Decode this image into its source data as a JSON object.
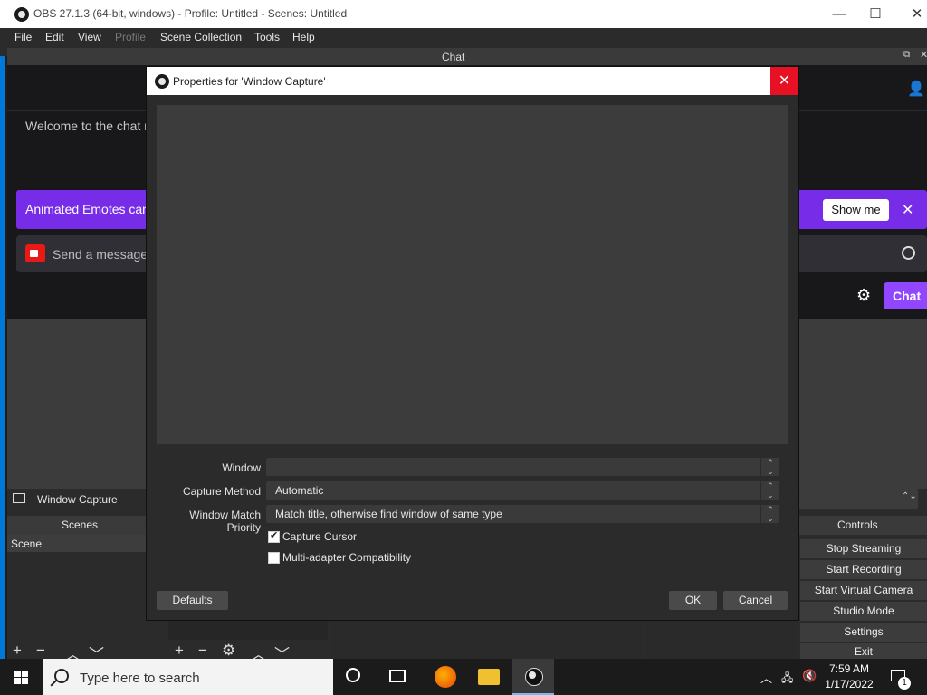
{
  "window": {
    "title": "OBS 27.1.3 (64-bit, windows) - Profile: Untitled - Scenes: Untitled",
    "minimize": "—",
    "maximize": "☐",
    "close": "✕"
  },
  "menu": [
    "File",
    "Edit",
    "View",
    "Profile",
    "Scene Collection",
    "Tools",
    "Help"
  ],
  "chat_dock": {
    "title": "Chat",
    "welcome": "Welcome to the chat r",
    "promo_text": "Animated Emotes can",
    "show_me": "Show me",
    "message_placeholder": "Send a message",
    "chat_button": "Chat"
  },
  "source_row": {
    "name": "Window Capture"
  },
  "scenes": {
    "title": "Scenes",
    "items": [
      "Scene"
    ]
  },
  "controls": {
    "title": "Controls",
    "buttons": [
      "Stop Streaming",
      "Start Recording",
      "Start Virtual Camera",
      "Studio Mode",
      "Settings",
      "Exit"
    ]
  },
  "dialog": {
    "title": "Properties for 'Window Capture'",
    "fields": [
      {
        "label": "Window",
        "value": ""
      },
      {
        "label": "Capture Method",
        "value": "Automatic"
      },
      {
        "label": "Window Match Priority",
        "value": "Match title, otherwise find window of same type"
      }
    ],
    "checkboxes": [
      {
        "label": "Capture Cursor",
        "checked": true
      },
      {
        "label": "Multi-adapter Compatibility",
        "checked": false
      }
    ],
    "defaults_label": "Defaults",
    "ok_label": "OK",
    "cancel_label": "Cancel"
  },
  "taskbar": {
    "search_placeholder": "Type here to search",
    "time": "7:59 AM",
    "date": "1/17/2022",
    "notification_count": "1"
  },
  "colors": {
    "twitch_purple": "#772ce8",
    "chat_button": "#9147ff",
    "close_red": "#e81123"
  }
}
